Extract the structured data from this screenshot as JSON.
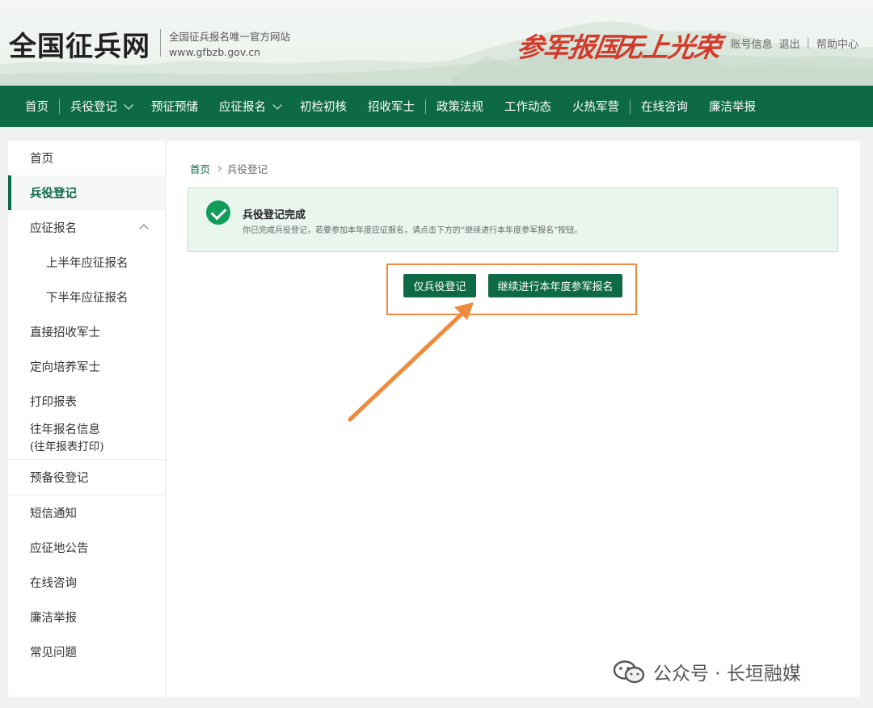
{
  "header": {
    "site_title": "全国征兵网",
    "site_subtitle": "全国征兵报名唯一官方网站",
    "site_url": "www.gfbzb.gov.cn",
    "slogan_1": "参军报国",
    "slogan_2": "无上光荣",
    "links": [
      "账号信息",
      "退出",
      "帮助中心"
    ]
  },
  "nav": {
    "items": [
      {
        "label": "首页"
      },
      {
        "label": "兵役登记"
      },
      {
        "label": "预征预储"
      },
      {
        "label": "应征报名"
      },
      {
        "label": "初检初核"
      },
      {
        "label": "招收军士"
      },
      {
        "label": "政策法规"
      },
      {
        "label": "工作动态"
      },
      {
        "label": "火热军营"
      },
      {
        "label": "在线咨询"
      },
      {
        "label": "廉洁举报"
      }
    ]
  },
  "sidebar": {
    "items": [
      {
        "label": "首页"
      },
      {
        "label": "兵役登记"
      },
      {
        "label": "应征报名"
      },
      {
        "label": "上半年应征报名"
      },
      {
        "label": "下半年应征报名"
      },
      {
        "label": "直接招收军士"
      },
      {
        "label": "定向培养军士"
      },
      {
        "label": "打印报表"
      },
      {
        "label": "往年报名信息",
        "label2": "(往年报表打印)"
      },
      {
        "label": "预备役登记"
      },
      {
        "label": "短信通知"
      },
      {
        "label": "应征地公告"
      },
      {
        "label": "在线咨询"
      },
      {
        "label": "廉洁举报"
      },
      {
        "label": "常见问题"
      }
    ]
  },
  "main": {
    "breadcrumb": {
      "home": "首页",
      "current": "兵役登记"
    },
    "success": {
      "title": "兵役登记完成",
      "text": "你已完成兵役登记，若要参加本年度应征报名，请点击下方的“继续进行本年度参军报名”按钮。"
    },
    "buttons": {
      "only_register": "仅兵役登记",
      "continue": "继续进行本年度参军报名"
    }
  },
  "watermark": {
    "text": "公众号 · 长垣融媒"
  },
  "colors": {
    "primary": "#0e6a45",
    "highlight": "#f08a3c",
    "success": "#129c5a"
  }
}
